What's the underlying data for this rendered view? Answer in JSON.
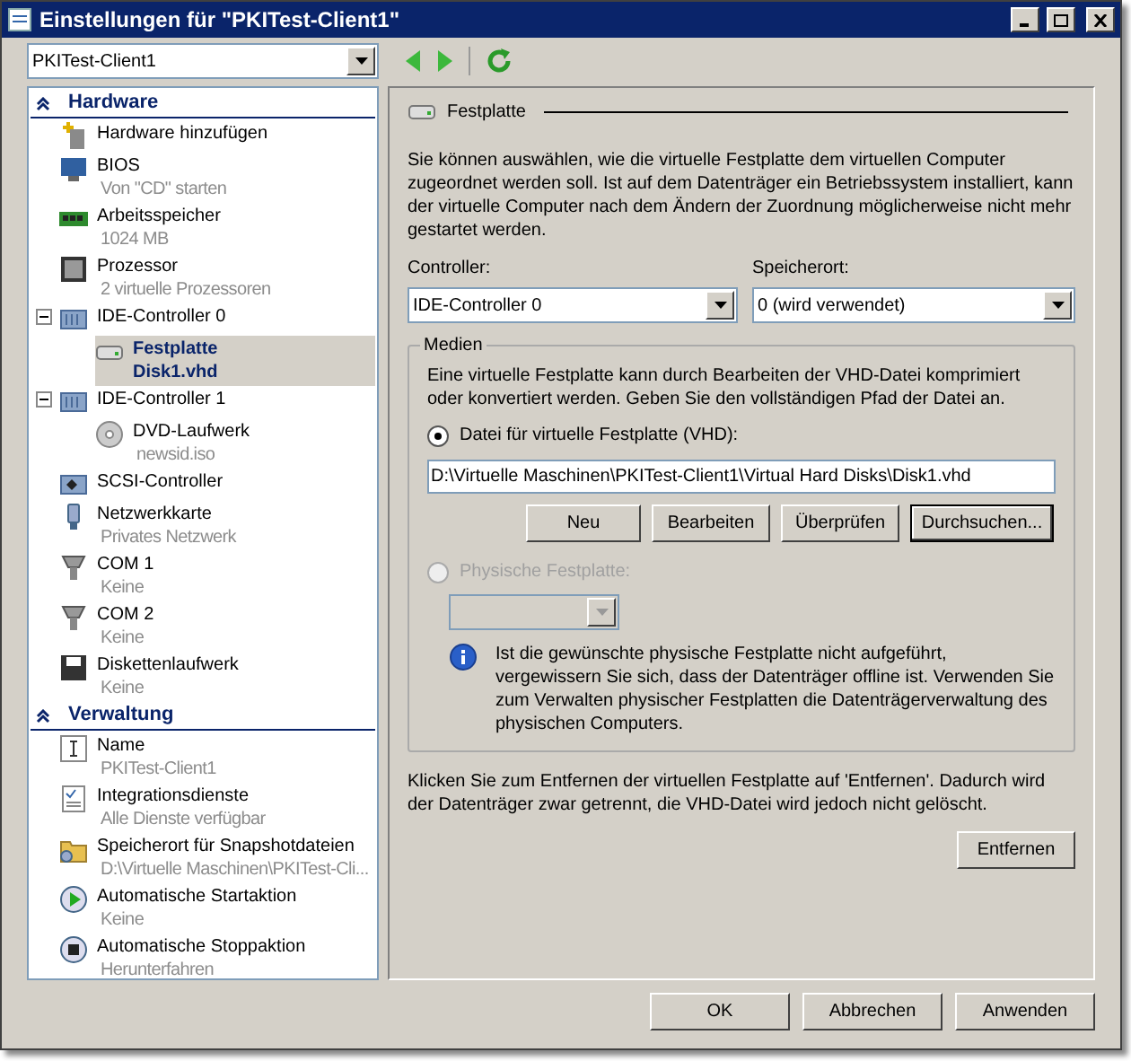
{
  "window": {
    "title": "Einstellungen für \"PKITest-Client1\""
  },
  "vm_select": {
    "value": "PKITest-Client1"
  },
  "sections": [
    {
      "title": "Hardware",
      "expanded": true,
      "items": [
        {
          "kind": "add",
          "label": "Hardware hinzufügen",
          "selected": false
        },
        {
          "kind": "bios",
          "label": "BIOS",
          "detail": "Von \"CD\" starten",
          "selected": false
        },
        {
          "kind": "memory",
          "label": "Arbeitsspeicher",
          "detail": "1024 MB",
          "selected": false
        },
        {
          "kind": "cpu",
          "label": "Prozessor",
          "detail": "2 virtuelle Prozessoren",
          "selected": false
        },
        {
          "kind": "controller",
          "label": "IDE-Controller 0",
          "selected": false,
          "expanded": true,
          "children": [
            {
              "kind": "disk",
              "label": "Festplatte",
              "detail": "Disk1.vhd",
              "selected": true
            }
          ]
        },
        {
          "kind": "controller",
          "label": "IDE-Controller 1",
          "selected": false,
          "expanded": true,
          "children": [
            {
              "kind": "dvd",
              "label": "DVD-Laufwerk",
              "detail": "newsid.iso",
              "selected": false
            }
          ]
        },
        {
          "kind": "scsi",
          "label": "SCSI-Controller",
          "selected": false
        },
        {
          "kind": "network",
          "label": "Netzwerkkarte",
          "detail": "Privates Netzwerk",
          "selected": false
        },
        {
          "kind": "com",
          "label": "COM 1",
          "detail": "Keine",
          "selected": false
        },
        {
          "kind": "com",
          "label": "COM 2",
          "detail": "Keine",
          "selected": false
        },
        {
          "kind": "floppy",
          "label": "Diskettenlaufwerk",
          "detail": "Keine",
          "selected": false
        }
      ]
    },
    {
      "title": "Verwaltung",
      "expanded": true,
      "items": [
        {
          "kind": "name",
          "label": "Name",
          "detail": "PKITest-Client1",
          "selected": false
        },
        {
          "kind": "integration",
          "label": "Integrationsdienste",
          "detail": "Alle Dienste verfügbar",
          "selected": false
        },
        {
          "kind": "folder",
          "label": "Speicherort für Snapshotdateien",
          "detail": "D:\\Virtuelle Maschinen\\PKITest-Cli...",
          "selected": false
        },
        {
          "kind": "start",
          "label": "Automatische Startaktion",
          "detail": "Keine",
          "selected": false
        },
        {
          "kind": "stop",
          "label": "Automatische Stoppaktion",
          "detail": "Herunterfahren",
          "selected": false
        }
      ]
    }
  ],
  "panel": {
    "title": "Festplatte",
    "intro": "Sie können auswählen, wie die virtuelle Festplatte dem virtuellen Computer zugeordnet werden soll. Ist auf dem Datenträger ein Betriebssystem installiert, kann der virtuelle Computer nach dem Ändern der Zuordnung möglicherweise nicht mehr gestartet werden.",
    "controller": {
      "label": "Controller:",
      "value": "IDE-Controller 0"
    },
    "location": {
      "label": "Speicherort:",
      "value": "0 (wird verwendet)"
    },
    "media": {
      "title": "Medien",
      "text": "Eine virtuelle Festplatte kann durch Bearbeiten der VHD-Datei komprimiert oder konvertiert werden. Geben Sie den vollständigen Pfad der Datei an.",
      "options": [
        {
          "label": "Datei für virtuelle Festplatte (VHD):",
          "selected": true,
          "disabled": false
        },
        {
          "label": "Physische Festplatte:",
          "selected": false,
          "disabled": true
        }
      ],
      "path": "D:\\Virtuelle Maschinen\\PKITest-Client1\\Virtual Hard Disks\\Disk1.vhd",
      "buttons": [
        {
          "label": "Neu",
          "default": false
        },
        {
          "label": "Bearbeiten",
          "default": false
        },
        {
          "label": "Überprüfen",
          "default": false
        },
        {
          "label": "Durchsuchen...",
          "default": true
        }
      ],
      "info": "Ist die gewünschte physische Festplatte nicht aufgeführt, vergewissern Sie sich, dass der Datenträger offline ist. Verwenden Sie zum Verwalten physischer Festplatten die Datenträgerverwaltung des physischen Computers."
    },
    "remove_text": "Klicken Sie zum Entfernen der virtuellen Festplatte auf 'Entfernen'. Dadurch wird der Datenträger zwar getrennt, die VHD-Datei wird jedoch nicht gelöscht.",
    "remove_button": "Entfernen"
  },
  "buttons": [
    "OK",
    "Abbrechen",
    "Anwenden"
  ]
}
